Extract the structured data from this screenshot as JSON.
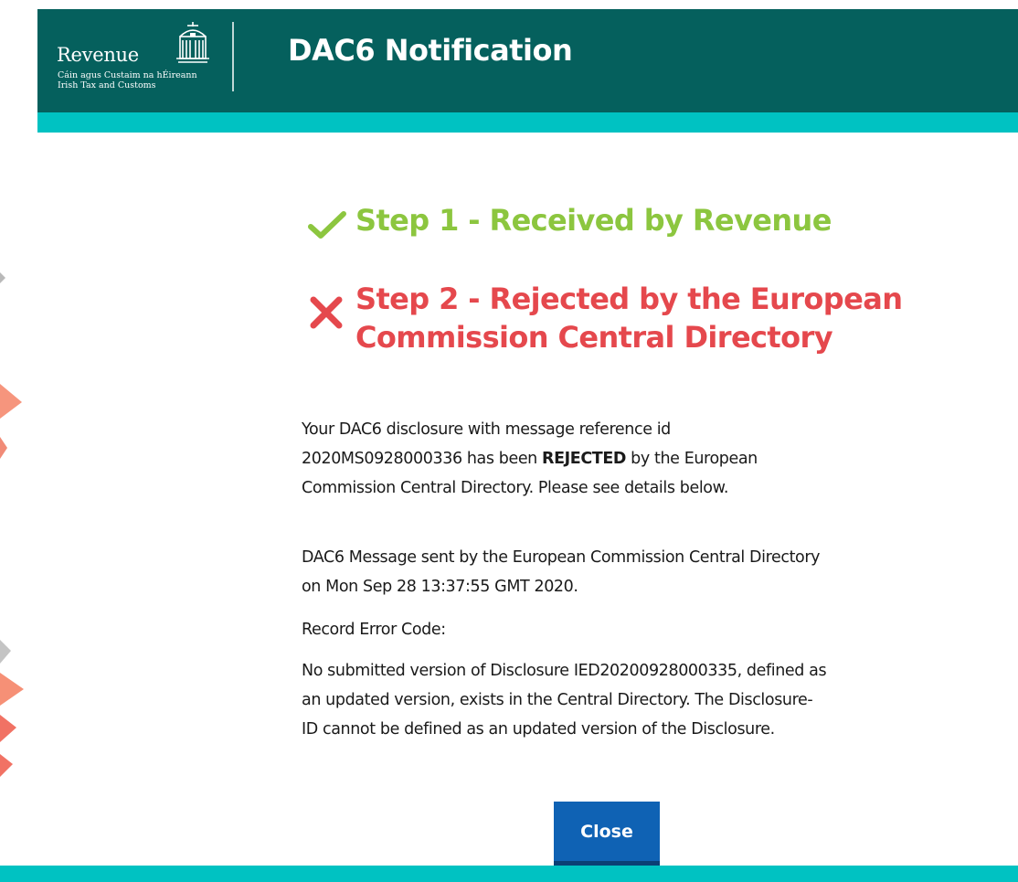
{
  "header": {
    "logo_name": "Revenue",
    "logo_subtitle_irish": "Cáin agus Custaim na hÉireann",
    "logo_subtitle_english": "Irish Tax and Customs",
    "app_title": "DAC6 Notification"
  },
  "steps": [
    {
      "status": "success",
      "icon": "check-icon",
      "label": "Step 1 - Received by Revenue",
      "color": "#8cc63f"
    },
    {
      "status": "error",
      "icon": "cross-icon",
      "label_line1": "Step 2 - Rejected by the European",
      "label_line2": "Commission Central Directory",
      "color": "#e5484d"
    }
  ],
  "message": {
    "p1_line1": "Your DAC6 disclosure with message reference id",
    "p1_line2_prefix": "2020MS0928000336 has been ",
    "p1_line2_emphasis": "REJECTED",
    "p1_line2_suffix": " by the European",
    "p1_line3": "Commission Central Directory. Please see details below.",
    "p2_line1": "DAC6 Message sent by the European Commission Central Directory",
    "p2_line2": "on Mon Sep 28 13:37:55 GMT 2020.",
    "error_code_label": "Record Error Code:",
    "error_line1": "No submitted version of Disclosure IED20200928000335, defined as",
    "error_line2": "an updated version, exists in the Central Directory. The Disclosure-",
    "error_line3": "ID cannot be defined as an updated version of the Disclosure."
  },
  "actions": {
    "close_label": "Close"
  },
  "colors": {
    "header_bg": "#05605d",
    "accent_band": "#00c2c2",
    "success": "#8cc63f",
    "error": "#e5484d",
    "primary_button": "#0f62b4"
  }
}
